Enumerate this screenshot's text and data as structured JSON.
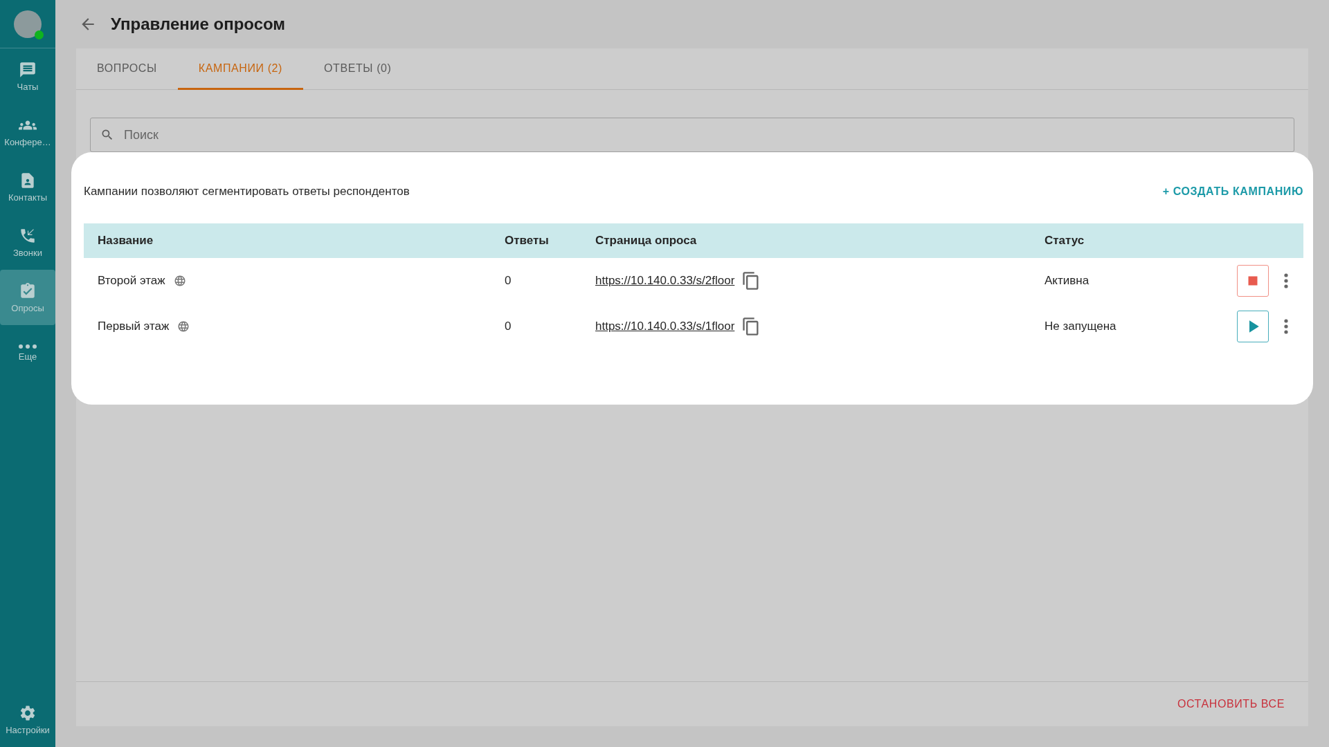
{
  "sidebar": {
    "user": {
      "online": true
    },
    "items": [
      {
        "label": "Чаты",
        "selected": false
      },
      {
        "label": "Конфере…",
        "selected": false
      },
      {
        "label": "Контакты",
        "selected": false
      },
      {
        "label": "Звонки",
        "selected": false
      },
      {
        "label": "Опросы",
        "selected": true
      },
      {
        "label": "Еще",
        "selected": false
      }
    ],
    "settings": {
      "label": "Настройки",
      "selected": false
    }
  },
  "header": {
    "title": "Управление опросом"
  },
  "tabs": [
    {
      "label": "ВОПРОСЫ",
      "selected": false
    },
    {
      "label": "КАМПАНИИ (2)",
      "selected": true
    },
    {
      "label": "ОТВЕТЫ (0)",
      "selected": false
    }
  ],
  "search": {
    "placeholder": "Поиск"
  },
  "campaigns": {
    "description": "Кампании позволяют сегментировать ответы респондентов",
    "create_button": "+ СОЗДАТЬ КАМПАНИЮ",
    "columns": [
      "Название",
      "Ответы",
      "Страница опроса",
      "Статус"
    ],
    "rows": [
      {
        "name": "Второй этаж",
        "answers": "0",
        "url": "https://10.140.0.33/s/2floor",
        "status": "Активна",
        "kind": "stop"
      },
      {
        "name": "Первый этаж",
        "answers": "0",
        "url": "https://10.140.0.33/s/1floor",
        "status": "Не запущена",
        "kind": "play"
      }
    ]
  },
  "footer": {
    "stop_all": "ОСТАНОВИТЬ ВСЕ"
  }
}
